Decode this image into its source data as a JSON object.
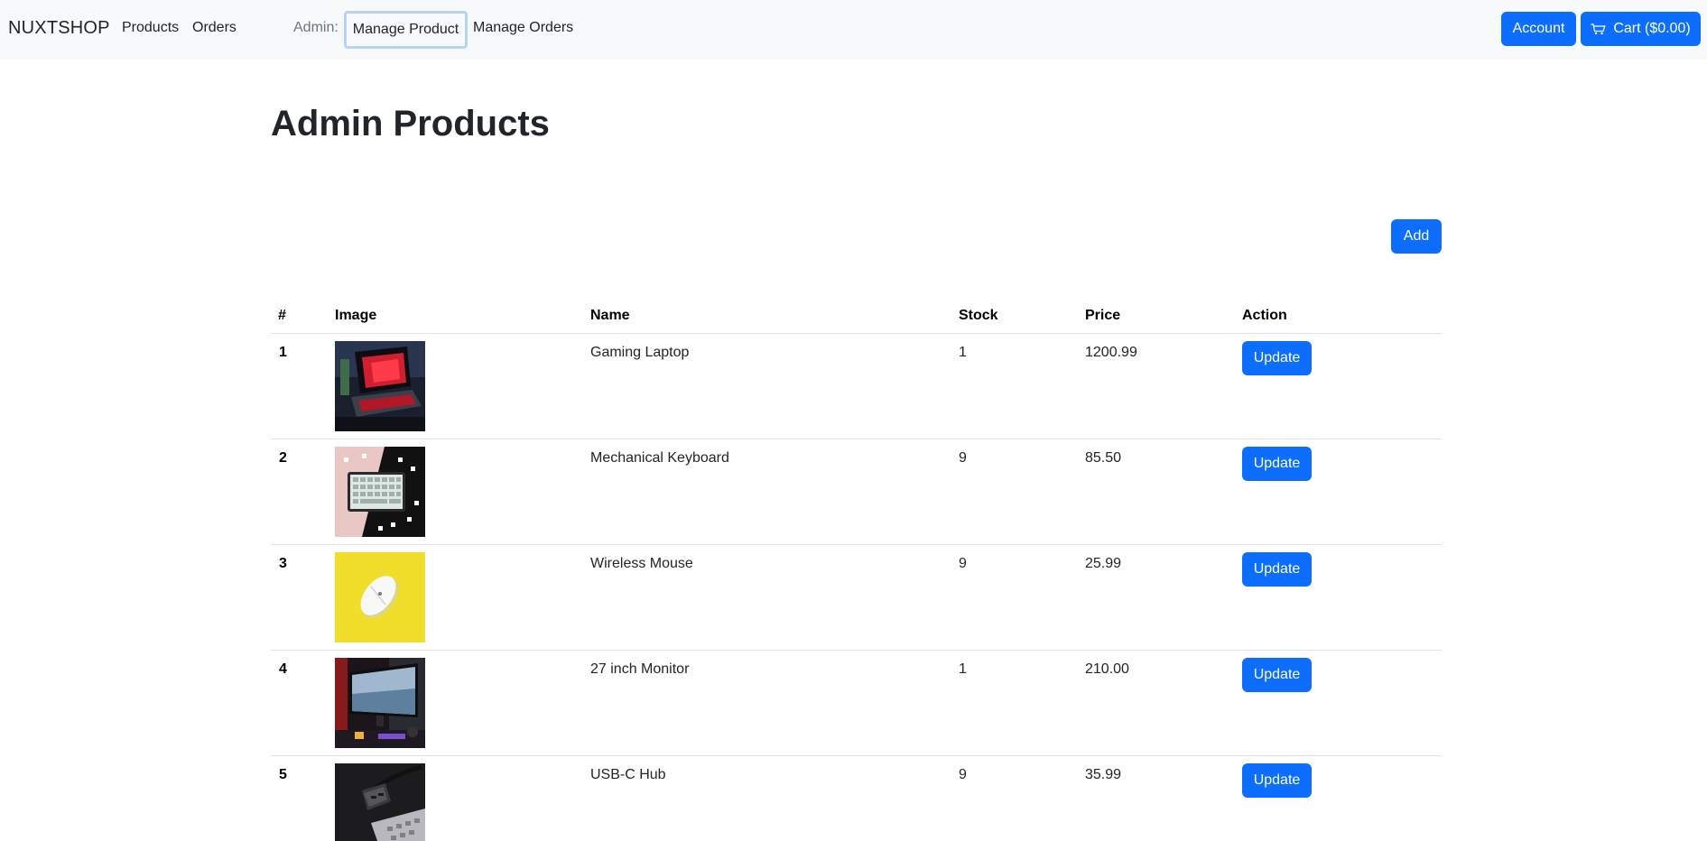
{
  "navbar": {
    "brand": "NUXTSHOP",
    "links": [
      "Products",
      "Orders"
    ],
    "admin_label": "Admin:",
    "admin_links": [
      "Manage Product",
      "Manage Orders"
    ],
    "account_label": "Account",
    "cart_label": "Cart ($0.00)"
  },
  "main": {
    "title": "Admin Products",
    "add_label": "Add"
  },
  "table": {
    "columns": [
      "#",
      "Image",
      "Name",
      "Stock",
      "Price",
      "Action"
    ],
    "action_label": "Update",
    "rows": [
      {
        "index": "1",
        "image": "gaming-laptop-image",
        "name": "Gaming Laptop",
        "stock": "1",
        "price": "1200.99"
      },
      {
        "index": "2",
        "image": "keyboard-image",
        "name": "Mechanical Keyboard",
        "stock": "9",
        "price": "85.50"
      },
      {
        "index": "3",
        "image": "mouse-image",
        "name": "Wireless Mouse",
        "stock": "9",
        "price": "25.99"
      },
      {
        "index": "4",
        "image": "monitor-image",
        "name": "27 inch Monitor",
        "stock": "1",
        "price": "210.00"
      },
      {
        "index": "5",
        "image": "usb-hub-image",
        "name": "USB-C Hub",
        "stock": "9",
        "price": "35.99"
      }
    ]
  },
  "colors": {
    "primary": "#0d6efd",
    "navbar_bg": "#f8f9fa",
    "focus_ring": "#b9d3f7",
    "muted": "#6c757d"
  }
}
